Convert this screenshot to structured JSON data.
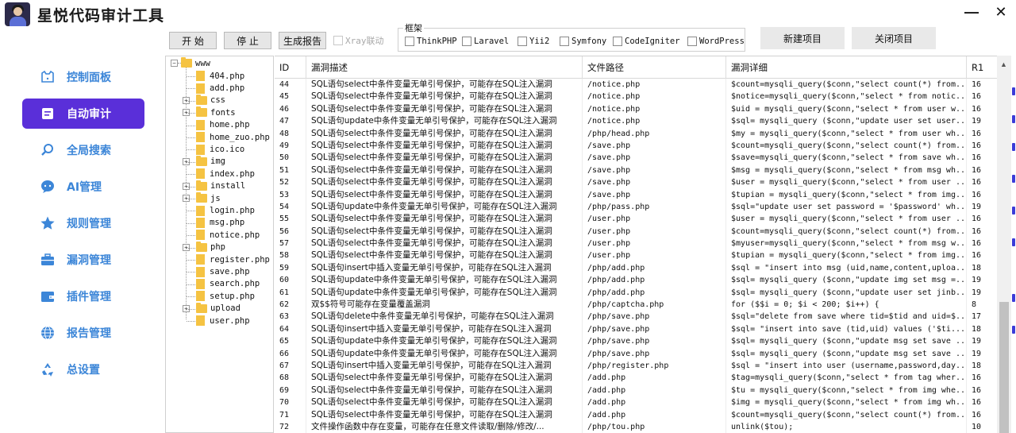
{
  "app": {
    "title": "星悦代码审计工具",
    "window_controls": {
      "minimize": "—",
      "close": "✕"
    },
    "accent_color": "#5a2fd9",
    "nav_text_color": "#3c86d8"
  },
  "sidebar": {
    "items": [
      {
        "label": "控制面板",
        "icon": "dashboard-icon",
        "active": false
      },
      {
        "label": "自动审计",
        "icon": "audit-doc-icon",
        "active": true
      },
      {
        "label": "全局搜索",
        "icon": "search-icon",
        "active": false
      },
      {
        "label": "AI管理",
        "icon": "chat-bubble-icon",
        "active": false
      },
      {
        "label": "规则管理",
        "icon": "star-icon",
        "active": false
      },
      {
        "label": "漏洞管理",
        "icon": "briefcase-icon",
        "active": false
      },
      {
        "label": "插件管理",
        "icon": "wallet-icon",
        "active": false
      },
      {
        "label": "报告管理",
        "icon": "globe-icon",
        "active": false
      },
      {
        "label": "总设置",
        "icon": "recycle-icon",
        "active": false
      }
    ]
  },
  "toolbar": {
    "start_label": "开 始",
    "stop_label": "停 止",
    "report_label": "生成报告",
    "xray_label": "Xray联动",
    "framework_legend": "框架",
    "frameworks": [
      "ThinkPHP",
      "Laravel",
      "Yii2",
      "Symfony",
      "CodeIgniter",
      "WordPress"
    ],
    "new_project_label": "新建项目",
    "close_project_label": "关闭项目"
  },
  "tree": {
    "root": "www",
    "items": [
      {
        "name": "404.php",
        "type": "file",
        "expandable": false
      },
      {
        "name": "add.php",
        "type": "file",
        "expandable": false
      },
      {
        "name": "css",
        "type": "folder",
        "expandable": true
      },
      {
        "name": "fonts",
        "type": "folder",
        "expandable": true
      },
      {
        "name": "home.php",
        "type": "file",
        "expandable": false
      },
      {
        "name": "home_zuo.php",
        "type": "file",
        "expandable": false
      },
      {
        "name": "ico.ico",
        "type": "file",
        "expandable": false
      },
      {
        "name": "img",
        "type": "folder",
        "expandable": true
      },
      {
        "name": "index.php",
        "type": "file",
        "expandable": false
      },
      {
        "name": "install",
        "type": "folder",
        "expandable": true
      },
      {
        "name": "js",
        "type": "folder",
        "expandable": true
      },
      {
        "name": "login.php",
        "type": "file",
        "expandable": false
      },
      {
        "name": "msg.php",
        "type": "file",
        "expandable": false
      },
      {
        "name": "notice.php",
        "type": "file",
        "expandable": false
      },
      {
        "name": "php",
        "type": "folder",
        "expandable": true
      },
      {
        "name": "register.php",
        "type": "file",
        "expandable": false
      },
      {
        "name": "save.php",
        "type": "file",
        "expandable": false
      },
      {
        "name": "search.php",
        "type": "file",
        "expandable": false
      },
      {
        "name": "setup.php",
        "type": "file",
        "expandable": false
      },
      {
        "name": "upload",
        "type": "folder",
        "expandable": true
      },
      {
        "name": "user.php",
        "type": "file",
        "expandable": false
      }
    ]
  },
  "table": {
    "columns": [
      "ID",
      "漏洞描述",
      "文件路径",
      "漏洞详细",
      "R1"
    ],
    "rows": [
      [
        "44",
        "SQL语句select中条件变量无单引号保护，可能存在SQL注入漏洞",
        "/notice.php",
        "$count=mysqli_query($conn,\"select count(*) from...",
        "16"
      ],
      [
        "45",
        "SQL语句select中条件变量无单引号保护，可能存在SQL注入漏洞",
        "/notice.php",
        "$notice=mysqli_query($conn,\"select * from notic...",
        "16"
      ],
      [
        "46",
        "SQL语句select中条件变量无单引号保护，可能存在SQL注入漏洞",
        "/notice.php",
        "$uid = mysqli_query($conn,\"select * from user w...",
        "16"
      ],
      [
        "47",
        "SQL语句update中条件变量无单引号保护，可能存在SQL注入漏洞",
        "/notice.php",
        "$sql= mysqli_query ($conn,\"update user set user...",
        "19"
      ],
      [
        "48",
        "SQL语句select中条件变量无单引号保护，可能存在SQL注入漏洞",
        "/php/head.php",
        "$my = mysqli_query($conn,\"select * from user wh...",
        "16"
      ],
      [
        "49",
        "SQL语句select中条件变量无单引号保护，可能存在SQL注入漏洞",
        "/save.php",
        "$count=mysqli_query($conn,\"select count(*) from...",
        "16"
      ],
      [
        "50",
        "SQL语句select中条件变量无单引号保护，可能存在SQL注入漏洞",
        "/save.php",
        "$save=mysqli_query($conn,\"select * from save wh...",
        "16"
      ],
      [
        "51",
        "SQL语句select中条件变量无单引号保护，可能存在SQL注入漏洞",
        "/save.php",
        "$msg = mysqli_query($conn,\"select * from msg wh...",
        "16"
      ],
      [
        "52",
        "SQL语句select中条件变量无单引号保护，可能存在SQL注入漏洞",
        "/save.php",
        "$user = mysqli_query($conn,\"select * from user ...",
        "16"
      ],
      [
        "53",
        "SQL语句select中条件变量无单引号保护，可能存在SQL注入漏洞",
        "/save.php",
        "$tupian = mysqli_query($conn,\"select * from img...",
        "16"
      ],
      [
        "54",
        "SQL语句update中条件变量无单引号保护，可能存在SQL注入漏洞",
        "/php/pass.php",
        "$sql=\"update user set password = '$password' wh...",
        "19"
      ],
      [
        "55",
        "SQL语句select中条件变量无单引号保护，可能存在SQL注入漏洞",
        "/user.php",
        "$user = mysqli_query($conn,\"select * from user ...",
        "16"
      ],
      [
        "56",
        "SQL语句select中条件变量无单引号保护，可能存在SQL注入漏洞",
        "/user.php",
        "$count=mysqli_query($conn,\"select count(*) from...",
        "16"
      ],
      [
        "57",
        "SQL语句select中条件变量无单引号保护，可能存在SQL注入漏洞",
        "/user.php",
        "$myuser=mysqli_query($conn,\"select * from msg w...",
        "16"
      ],
      [
        "58",
        "SQL语句select中条件变量无单引号保护，可能存在SQL注入漏洞",
        "/user.php",
        "$tupian = mysqli_query($conn,\"select * from img...",
        "16"
      ],
      [
        "59",
        "SQL语句insert中插入变量无单引号保护，可能存在SQL注入漏洞",
        "/php/add.php",
        "$sql = \"insert into msg (uid,name,content,uploa...",
        "18"
      ],
      [
        "60",
        "SQL语句update中条件变量无单引号保护，可能存在SQL注入漏洞",
        "/php/add.php",
        "$sql= mysqli_query ($conn,\"update img set msg =...",
        "19"
      ],
      [
        "61",
        "SQL语句update中条件变量无单引号保护，可能存在SQL注入漏洞",
        "/php/add.php",
        "$sql= mysqli_query ($conn,\"update user set jinb...",
        "19"
      ],
      [
        "62",
        "双$$符号可能存在变量覆盖漏洞",
        "/php/captcha.php",
        "for ($$i = 0; $i < 200; $i++) {",
        "8"
      ],
      [
        "63",
        "SQL语句delete中条件变量无单引号保护，可能存在SQL注入漏洞",
        "/php/save.php",
        "$sql=\"delete from save where tid=$tid and uid=$...",
        "17"
      ],
      [
        "64",
        "SQL语句insert中插入变量无单引号保护，可能存在SQL注入漏洞",
        "/php/save.php",
        "$sql= \"insert into save (tid,uid) values ('$ti...",
        "18"
      ],
      [
        "65",
        "SQL语句update中条件变量无单引号保护，可能存在SQL注入漏洞",
        "/php/save.php",
        "$sql= mysqli_query ($conn,\"update msg set save ...",
        "19"
      ],
      [
        "66",
        "SQL语句update中条件变量无单引号保护，可能存在SQL注入漏洞",
        "/php/save.php",
        "$sql= mysqli_query ($conn,\"update msg set save ...",
        "19"
      ],
      [
        "67",
        "SQL语句insert中插入变量无单引号保护，可能存在SQL注入漏洞",
        "/php/register.php",
        "$sql = \"insert into user (username,password,day...",
        "18"
      ],
      [
        "68",
        "SQL语句select中条件变量无单引号保护，可能存在SQL注入漏洞",
        "/add.php",
        "$tag=mysqli_query($conn,\"select * from tag wher...",
        "16"
      ],
      [
        "69",
        "SQL语句select中条件变量无单引号保护，可能存在SQL注入漏洞",
        "/add.php",
        "$tu = mysqli_query($conn,\"select * from img whe...",
        "16"
      ],
      [
        "70",
        "SQL语句select中条件变量无单引号保护，可能存在SQL注入漏洞",
        "/add.php",
        "$img = mysqli_query($conn,\"select * from img wh...",
        "16"
      ],
      [
        "71",
        "SQL语句select中条件变量无单引号保护，可能存在SQL注入漏洞",
        "/add.php",
        "$count=mysqli_query($conn,\"select count(*) from...",
        "16"
      ],
      [
        "72",
        "文件操作函数中存在变量，可能存在任意文件读取/删除/修改/...",
        "/php/tou.php",
        "unlink($tou);",
        "10"
      ]
    ]
  }
}
